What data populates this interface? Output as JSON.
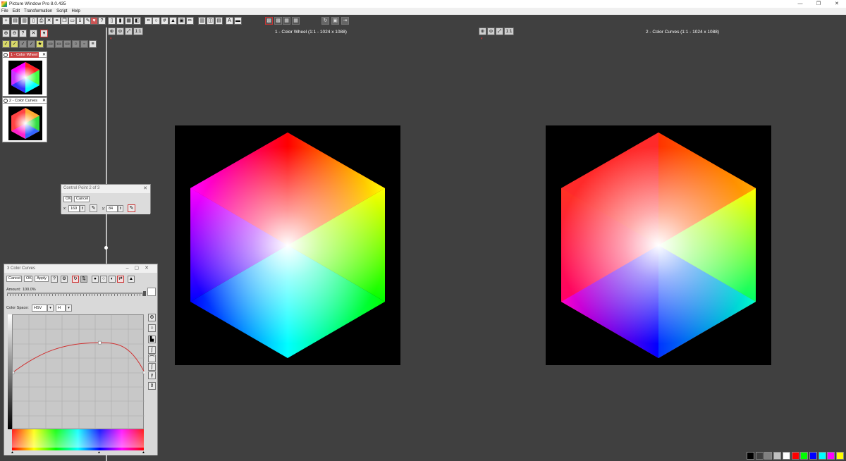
{
  "window": {
    "title": "Picture Window Pro 8.0.435",
    "minimize": "—",
    "maximize": "❐",
    "close": "✕"
  },
  "menu": [
    "File",
    "Edit",
    "Transformation",
    "Script",
    "Help"
  ],
  "views": [
    {
      "title": "1 - Color Wheel (1:1 - 1024 x 1088)",
      "zoom_label": "1:1"
    },
    {
      "title": "2 - Color Curves (1:1 - 1024 x 1088)",
      "zoom_label": "1:1"
    }
  ],
  "thumbnails": [
    {
      "label": "1 - Color Wheel",
      "close": "✕"
    },
    {
      "label": "2 - Color Curves",
      "close": "✕"
    }
  ],
  "control_point_dialog": {
    "title": "Control Point 2 of 3",
    "close": "✕",
    "ok": "OK",
    "cancel": "Cancel",
    "x_label": "x:",
    "x_value": "169",
    "y_label": "y:",
    "y_value": "84"
  },
  "curves_dialog": {
    "title": "3 Color Curves",
    "cancel": "Cancel",
    "ok": "OK",
    "apply": "Apply",
    "amount_label": "Amount:",
    "amount_value": "100.0%",
    "color_space_label": "Color Space:",
    "color_space_value": "HSV",
    "channel_value": "H",
    "curve_points": [
      [
        0,
        0.5
      ],
      [
        0.66,
        0.76
      ],
      [
        1,
        0.5
      ]
    ]
  },
  "palette": [
    "#000000",
    "#404040",
    "#808080",
    "#c0c0c0",
    "#ffffff",
    "#ff0000",
    "#00ff00",
    "#0000ff",
    "#00ffff",
    "#ff00ff",
    "#ffff00"
  ]
}
